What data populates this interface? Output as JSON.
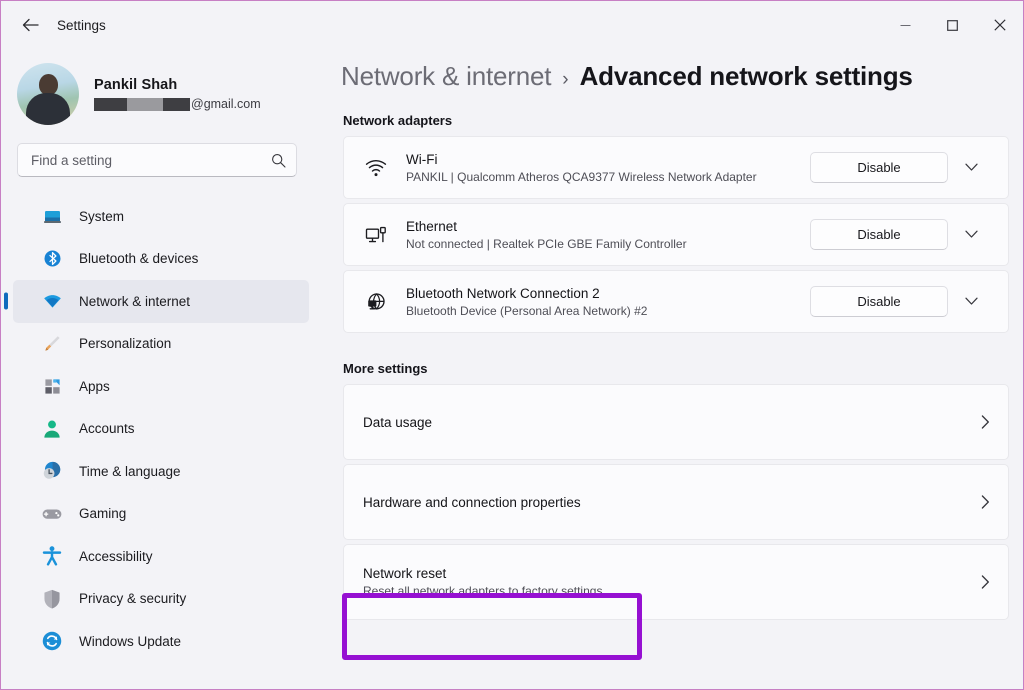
{
  "titlebar": {
    "back_label": "Back",
    "title": "Settings",
    "minimize_label": "Minimize",
    "maximize_label": "Maximize",
    "close_label": "Close"
  },
  "sidebar": {
    "profile": {
      "name": "Pankil Shah",
      "email_suffix": "@gmail.com"
    },
    "search": {
      "placeholder": "Find a setting",
      "value": "",
      "icon": "search-icon"
    },
    "items": [
      {
        "label": "System",
        "icon": "display-icon",
        "active": false
      },
      {
        "label": "Bluetooth & devices",
        "icon": "bluetooth-icon",
        "active": false
      },
      {
        "label": "Network & internet",
        "icon": "wifi-icon",
        "active": true
      },
      {
        "label": "Personalization",
        "icon": "paintbrush-icon",
        "active": false
      },
      {
        "label": "Apps",
        "icon": "apps-grid-icon",
        "active": false
      },
      {
        "label": "Accounts",
        "icon": "person-icon",
        "active": false
      },
      {
        "label": "Time & language",
        "icon": "clock-icon",
        "active": false
      },
      {
        "label": "Gaming",
        "icon": "gamepad-icon",
        "active": false
      },
      {
        "label": "Accessibility",
        "icon": "accessibility-icon",
        "active": false
      },
      {
        "label": "Privacy & security",
        "icon": "shield-icon",
        "active": false
      },
      {
        "label": "Windows Update",
        "icon": "update-arrows-icon",
        "active": false
      }
    ]
  },
  "main": {
    "breadcrumb": {
      "parent": "Network & internet",
      "separator": "›",
      "current": "Advanced network settings"
    },
    "adapters_section_title": "Network adapters",
    "adapters": [
      {
        "name": "Wi-Fi",
        "detail": "PANKIL | Qualcomm Atheros QCA9377 Wireless Network Adapter",
        "button": "Disable",
        "icon": "wifi-signal-icon",
        "expand_icon": "chevron-down-icon"
      },
      {
        "name": "Ethernet",
        "detail": "Not connected | Realtek PCIe GBE Family Controller",
        "button": "Disable",
        "icon": "ethernet-icon",
        "expand_icon": "chevron-down-icon"
      },
      {
        "name": "Bluetooth Network Connection 2",
        "detail": "Bluetooth Device (Personal Area Network) #2",
        "button": "Disable",
        "icon": "globe-network-icon",
        "expand_icon": "chevron-down-icon"
      }
    ],
    "more_section_title": "More settings",
    "more_settings": [
      {
        "title": "Data usage",
        "sub": "",
        "chevron": "chevron-right-icon",
        "highlighted": false
      },
      {
        "title": "Hardware and connection properties",
        "sub": "",
        "chevron": "chevron-right-icon",
        "highlighted": false
      },
      {
        "title": "Network reset",
        "sub": "Reset all network adapters to factory settings",
        "chevron": "chevron-right-icon",
        "highlighted": true
      }
    ]
  },
  "annotation": {
    "color": "#9610d2",
    "target": "Network reset"
  }
}
